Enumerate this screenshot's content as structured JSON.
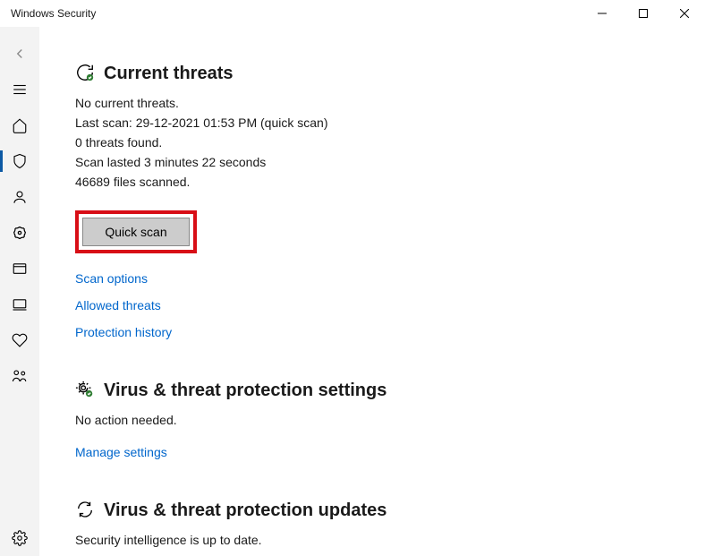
{
  "window": {
    "title": "Windows Security"
  },
  "sections": {
    "threats": {
      "title": "Current threats",
      "no_threats": "No current threats.",
      "last_scan": "Last scan: 29-12-2021 01:53 PM (quick scan)",
      "found": "0 threats found.",
      "duration": "Scan lasted 3 minutes 22 seconds",
      "files": "46689 files scanned.",
      "quick_scan_btn": "Quick scan",
      "scan_options": "Scan options",
      "allowed_threats": "Allowed threats",
      "protection_history": "Protection history"
    },
    "settings": {
      "title": "Virus & threat protection settings",
      "status": "No action needed.",
      "manage": "Manage settings"
    },
    "updates": {
      "title": "Virus & threat protection updates",
      "status": "Security intelligence is up to date."
    }
  }
}
